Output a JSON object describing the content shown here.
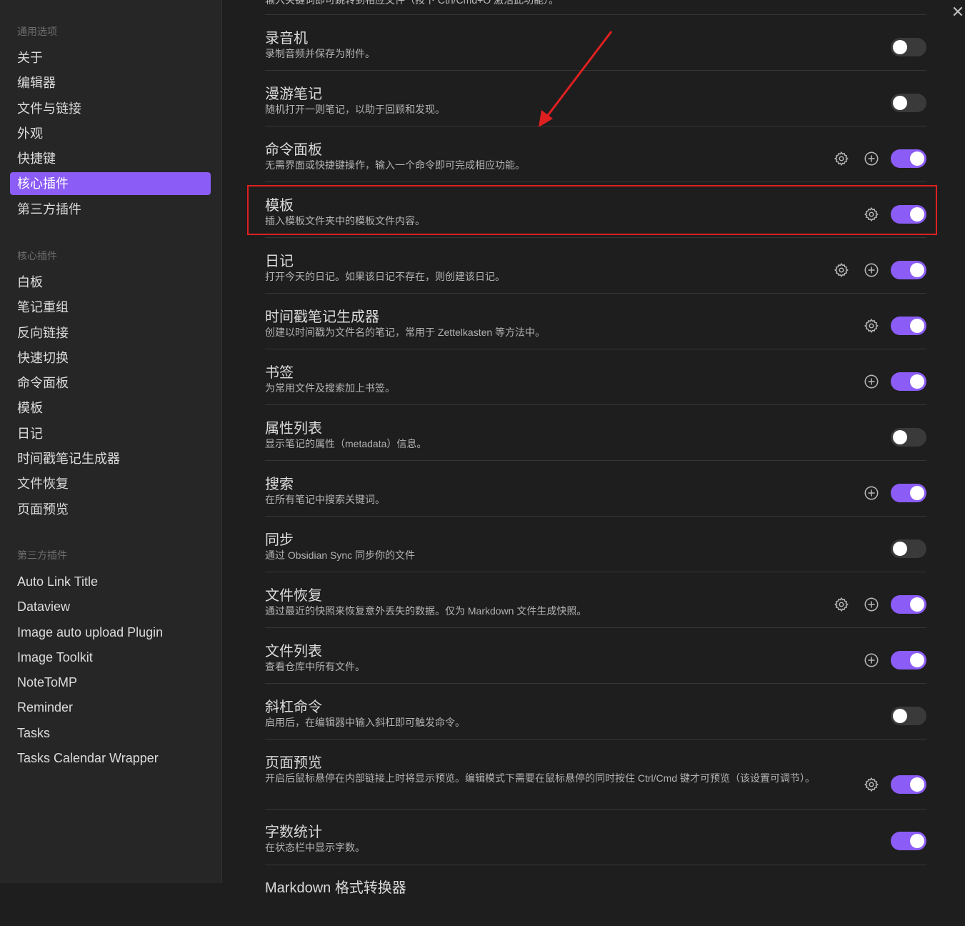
{
  "sidebar": {
    "general_header": "通用选项",
    "general_items": [
      "关于",
      "编辑器",
      "文件与链接",
      "外观",
      "快捷键",
      "核心插件",
      "第三方插件"
    ],
    "core_header": "核心插件",
    "core_items": [
      "白板",
      "笔记重组",
      "反向链接",
      "快速切换",
      "命令面板",
      "模板",
      "日记",
      "时间戳笔记生成器",
      "文件恢复",
      "页面预览"
    ],
    "community_header": "第三方插件",
    "community_items": [
      "Auto Link Title",
      "Dataview",
      "Image auto upload Plugin",
      "Image Toolkit",
      "NoteToMP",
      "Reminder",
      "Tasks",
      "Tasks Calendar Wrapper"
    ]
  },
  "top_cut_text": "输入关键词即可跳转到相应文件（按下 Ctrl/Cmd+O 激活此功能）。",
  "close_icon": "close-icon",
  "plugins": [
    {
      "title": "录音机",
      "desc": "录制音频并保存为附件。",
      "settings": false,
      "hotkey": false,
      "enabled": false
    },
    {
      "title": "漫游笔记",
      "desc": "随机打开一则笔记，以助于回顾和发现。",
      "settings": false,
      "hotkey": false,
      "enabled": false
    },
    {
      "title": "命令面板",
      "desc": "无需界面或快捷键操作，输入一个命令即可完成相应功能。",
      "settings": true,
      "hotkey": true,
      "enabled": true
    },
    {
      "title": "模板",
      "desc": "插入模板文件夹中的模板文件内容。",
      "settings": true,
      "hotkey": false,
      "enabled": true
    },
    {
      "title": "日记",
      "desc": "打开今天的日记。如果该日记不存在，则创建该日记。",
      "settings": true,
      "hotkey": true,
      "enabled": true
    },
    {
      "title": "时间戳笔记生成器",
      "desc": "创建以时间戳为文件名的笔记，常用于 Zettelkasten 等方法中。",
      "settings": true,
      "hotkey": false,
      "enabled": true
    },
    {
      "title": "书签",
      "desc": "为常用文件及搜索加上书签。",
      "settings": false,
      "hotkey": true,
      "enabled": true
    },
    {
      "title": "属性列表",
      "desc": "显示笔记的属性（metadata）信息。",
      "settings": false,
      "hotkey": false,
      "enabled": false
    },
    {
      "title": "搜索",
      "desc": "在所有笔记中搜索关键词。",
      "settings": false,
      "hotkey": true,
      "enabled": true
    },
    {
      "title": "同步",
      "desc": "通过 Obsidian Sync 同步你的文件",
      "settings": false,
      "hotkey": false,
      "enabled": false
    },
    {
      "title": "文件恢复",
      "desc": "通过最近的快照来恢复意外丢失的数据。仅为 Markdown 文件生成快照。",
      "settings": true,
      "hotkey": true,
      "enabled": true
    },
    {
      "title": "文件列表",
      "desc": "查看仓库中所有文件。",
      "settings": false,
      "hotkey": true,
      "enabled": true
    },
    {
      "title": "斜杠命令",
      "desc": "启用后，在编辑器中输入斜杠即可触发命令。",
      "settings": false,
      "hotkey": false,
      "enabled": false
    },
    {
      "title": "页面预览",
      "desc": "开启后鼠标悬停在内部链接上时将显示预览。编辑模式下需要在鼠标悬停的同时按住 Ctrl/Cmd 键才可预览（该设置可调节）。",
      "settings": true,
      "hotkey": false,
      "enabled": true
    },
    {
      "title": "字数统计",
      "desc": "在状态栏中显示字数。",
      "settings": false,
      "hotkey": false,
      "enabled": true
    },
    {
      "title": "Markdown 格式转换器",
      "desc": "",
      "settings": false,
      "hotkey": false,
      "enabled": false
    }
  ],
  "annotation": {
    "highlighted_plugin": "模板",
    "color": "#e02020"
  },
  "accent_color": "#8b5cf6"
}
